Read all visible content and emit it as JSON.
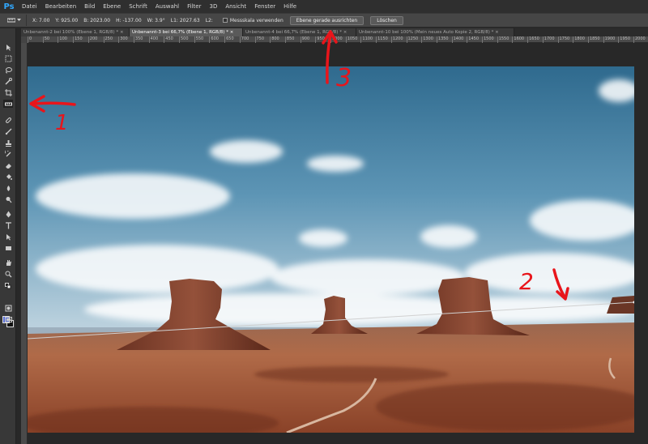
{
  "app": {
    "logo": "Ps"
  },
  "menu": [
    "Datei",
    "Bearbeiten",
    "Bild",
    "Ebene",
    "Schrift",
    "Auswahl",
    "Filter",
    "3D",
    "Ansicht",
    "Fenster",
    "Hilfe"
  ],
  "options": {
    "x": "X:  7.00",
    "y": "Y:  925.00",
    "b": "B:  2023.00",
    "h": "H:  -137.00",
    "w": "W:  3.9°",
    "l1": "L1:  2027.63",
    "l2": "L2:",
    "measure_scale_label": "Messskala verwenden",
    "straighten_button": "Ebene gerade ausrichten",
    "clear_button": "Löschen"
  },
  "tabs": [
    {
      "label": "Unbenannt-2 bei 100% (Ebene 1, RGB/8) *",
      "close": "×",
      "active": false
    },
    {
      "label": "Unbenannt-3 bei 66,7% (Ebene 1, RGB/8) *",
      "close": "×",
      "active": true
    },
    {
      "label": "Unbenannt-4 bei 66,7% (Ebene 1, RGB/8) *",
      "close": "×",
      "active": false
    },
    {
      "label": "Unbenannt-10 bei 100% (Mein neues Auto Kopie 2, RGB/8) *",
      "close": "×",
      "active": false
    }
  ],
  "ruler_ticks": [
    "0",
    "50",
    "100",
    "150",
    "200",
    "250",
    "300",
    "350",
    "400",
    "450",
    "500",
    "550",
    "600",
    "650",
    "700",
    "750",
    "800",
    "850",
    "900",
    "950",
    "1000",
    "1050",
    "1100",
    "1150",
    "1200",
    "1250",
    "1300",
    "1350",
    "1400",
    "1450",
    "1500",
    "1550",
    "1600",
    "1650",
    "1700",
    "1750",
    "1800",
    "1850",
    "1900",
    "1950",
    "2000"
  ],
  "annotations": {
    "mark_1": "1",
    "mark_2": "2",
    "mark_3": "3"
  },
  "colors": {
    "foreground": "#5a6fd6",
    "background": "#111111",
    "annotation_red": "#e8151b",
    "ps_blue": "#31a8ff"
  },
  "tools": [
    "move-tool-icon",
    "marquee-tool-icon",
    "lasso-tool-icon",
    "quick-select-tool-icon",
    "crop-tool-icon",
    "ruler-tool-icon",
    "healing-brush-icon",
    "brush-tool-icon",
    "clone-stamp-icon",
    "history-brush-icon",
    "eraser-tool-icon",
    "paint-bucket-icon",
    "blur-tool-icon",
    "dodge-tool-icon",
    "pen-tool-icon",
    "type-tool-icon",
    "path-select-icon",
    "shape-tool-icon",
    "hand-tool-icon",
    "zoom-tool-icon"
  ]
}
